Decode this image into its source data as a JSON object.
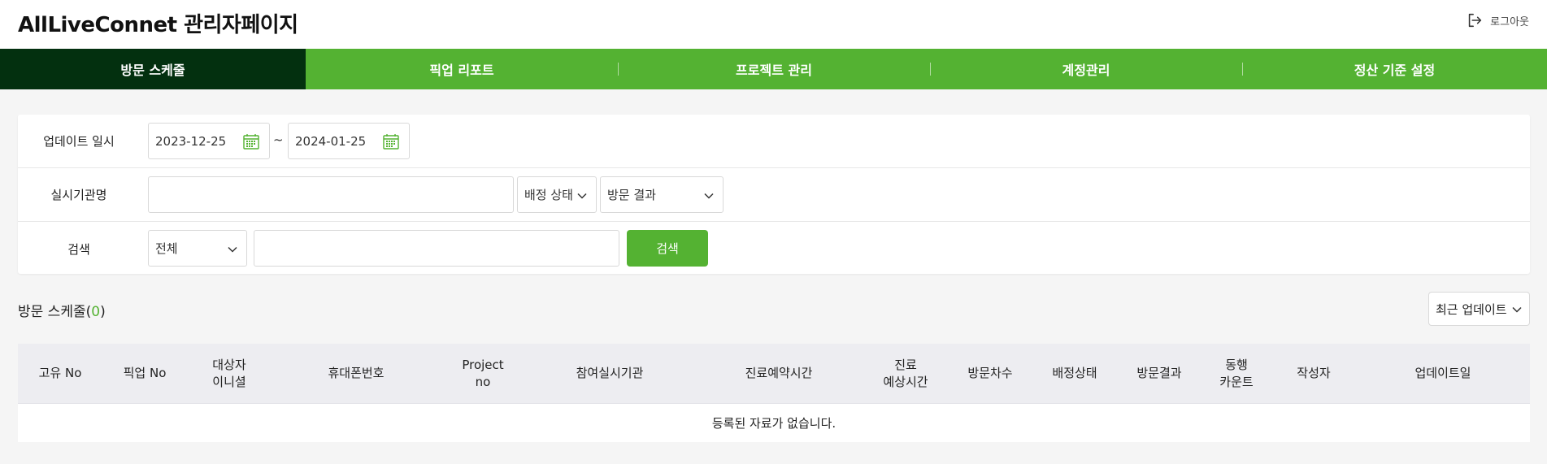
{
  "header": {
    "title": "AllLiveConnet 관리자페이지",
    "logout_label": "로그아웃"
  },
  "nav": {
    "items": [
      {
        "label": "방문 스케줄",
        "active": true
      },
      {
        "label": "픽업 리포트",
        "active": false
      },
      {
        "label": "프로젝트 관리",
        "active": false
      },
      {
        "label": "계정관리",
        "active": false
      },
      {
        "label": "정산 기준 설정",
        "active": false
      }
    ]
  },
  "filters": {
    "update_date": {
      "label": "업데이트 일시",
      "start": "2023-12-25",
      "separator": "~",
      "end": "2024-01-25"
    },
    "site": {
      "label": "실시기관명",
      "value": "",
      "assign_status": "배정 상태",
      "visit_result": "방문 결과"
    },
    "search": {
      "label": "검색",
      "scope": "전체",
      "query": "",
      "button_label": "검색"
    }
  },
  "list": {
    "title": "방문 스케줄(",
    "count": "0",
    "title_end": ")",
    "sort_label": "최근 업데이트",
    "columns": [
      "고유 No",
      "픽업 No",
      "대상자\n이니셜",
      "휴대폰번호",
      "Project\nno",
      "참여실시기관",
      "진료예약시간",
      "진료\n예상시간",
      "방문차수",
      "배정상태",
      "방문결과",
      "동행\n카운트",
      "작성자",
      "업데이트일"
    ],
    "empty_message": "등록된 자료가 없습니다."
  },
  "colors": {
    "brand_green": "#54b232",
    "active_nav": "#03300f",
    "header_row": "#ededf1"
  }
}
